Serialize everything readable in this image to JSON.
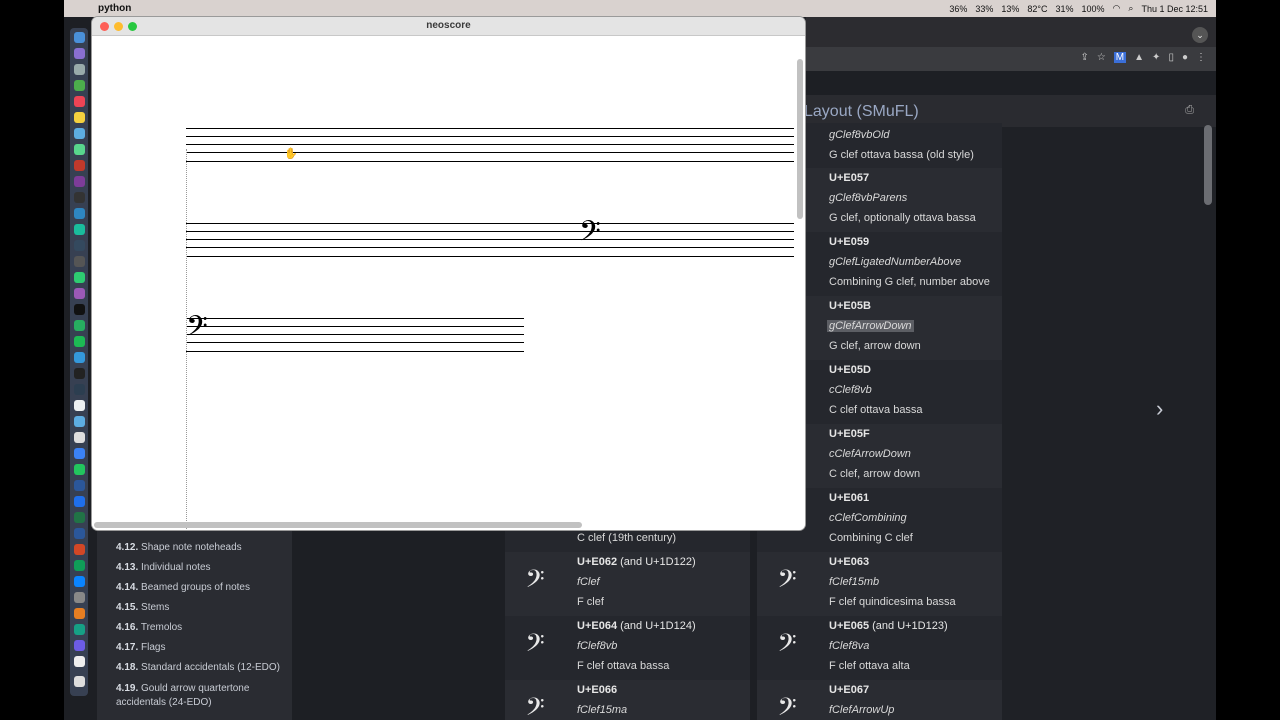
{
  "menubar": {
    "app_name": "python",
    "status": [
      "36%",
      "33%",
      "13%",
      "82°C",
      "31%",
      "100%"
    ],
    "datetime": "Thu 1 Dec  12:51"
  },
  "neoscore": {
    "title": "neoscore"
  },
  "doc": {
    "title_fragment": "Layout (SMuFL)",
    "prev_rows": [
      {
        "name": "gClef8vbOld",
        "desc": "G clef ottava bassa (old style)"
      }
    ],
    "right_rows": [
      {
        "code": "U+E057",
        "name": "gClef8vbParens",
        "desc": "G clef, optionally ottava bassa"
      },
      {
        "code": "U+E059",
        "name": "gClefLigatedNumberAbove",
        "desc": "Combining G clef, number above"
      },
      {
        "code": "U+E05B",
        "name": "gClefArrowDown",
        "desc": "G clef, arrow down"
      },
      {
        "code": "U+E05D",
        "name": "cClef8vb",
        "desc": "C clef ottava bassa"
      },
      {
        "code": "U+E05F",
        "name": "cClefArrowDown",
        "desc": "C clef, arrow down"
      },
      {
        "code": "U+E061",
        "name": "cClefCombining",
        "desc": "Combining C clef"
      }
    ],
    "left_partial_desc": "C clef (19th century)",
    "bottom_rows": [
      {
        "left": {
          "code": "U+E062",
          "extra": " (and U+1D122)",
          "name": "fClef",
          "desc": "F clef"
        },
        "right": {
          "code": "U+E063",
          "extra": "",
          "name": "fClef15mb",
          "desc": "F clef quindicesima bassa"
        }
      },
      {
        "left": {
          "code": "U+E064",
          "extra": " (and U+1D124)",
          "name": "fClef8vb",
          "desc": "F clef ottava bassa"
        },
        "right": {
          "code": "U+E065",
          "extra": " (and U+1D123)",
          "name": "fClef8va",
          "desc": "F clef ottava alta"
        }
      },
      {
        "left": {
          "code": "U+E066",
          "extra": "",
          "name": "fClef15ma",
          "desc": ""
        },
        "right": {
          "code": "U+E067",
          "extra": "",
          "name": "fClefArrowUp",
          "desc": ""
        }
      }
    ]
  },
  "sidebar": {
    "items": [
      {
        "num": "4.12.",
        "label": "Shape note noteheads"
      },
      {
        "num": "4.13.",
        "label": "Individual notes"
      },
      {
        "num": "4.14.",
        "label": "Beamed groups of notes"
      },
      {
        "num": "4.15.",
        "label": "Stems"
      },
      {
        "num": "4.16.",
        "label": "Tremolos"
      },
      {
        "num": "4.17.",
        "label": "Flags"
      },
      {
        "num": "4.18.",
        "label": "Standard accidentals (12-EDO)"
      },
      {
        "num": "4.19.",
        "label": "Gould arrow quartertone"
      },
      {
        "num": "",
        "label": "accidentals (24-EDO)"
      }
    ]
  }
}
